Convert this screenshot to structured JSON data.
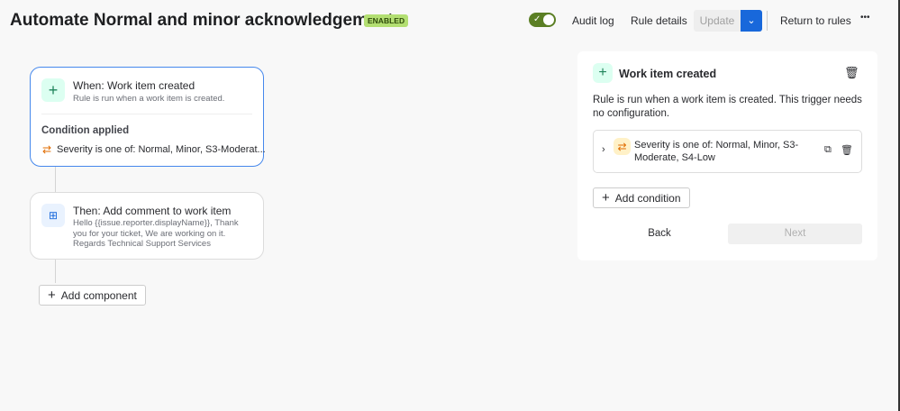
{
  "header": {
    "title": "Automate Normal and minor acknowledgement",
    "status_badge": "ENABLED",
    "toggle_on": true,
    "audit_log": "Audit log",
    "rule_details": "Rule details",
    "update": "Update",
    "return_to_rules": "Return to rules",
    "more": "•••"
  },
  "flow": {
    "trigger": {
      "title": "When: Work item created",
      "description": "Rule is run when a work item is created.",
      "condition_heading": "Condition applied",
      "condition": "Severity is one of: Normal, Minor, S3-Moderat..."
    },
    "action": {
      "title": "Then: Add comment to work item",
      "description": "Hello {{issue.reporter.displayName}}, Thank you for your ticket, We are working on it. Regards Technical Support Services"
    },
    "add_component": "Add component"
  },
  "panel": {
    "title": "Work item created",
    "description": "Rule is run when a work item is created. This trigger needs no configuration.",
    "condition": "Severity is one of: Normal, Minor, S3-Moderate, S4-Low",
    "add_condition": "Add condition",
    "back": "Back",
    "next": "Next"
  },
  "colors": {
    "accent": "#1868db",
    "toggle": "#5b7f24",
    "trigger_icon_bg": "#dcfff1",
    "condition_icon": "#e06c00"
  }
}
